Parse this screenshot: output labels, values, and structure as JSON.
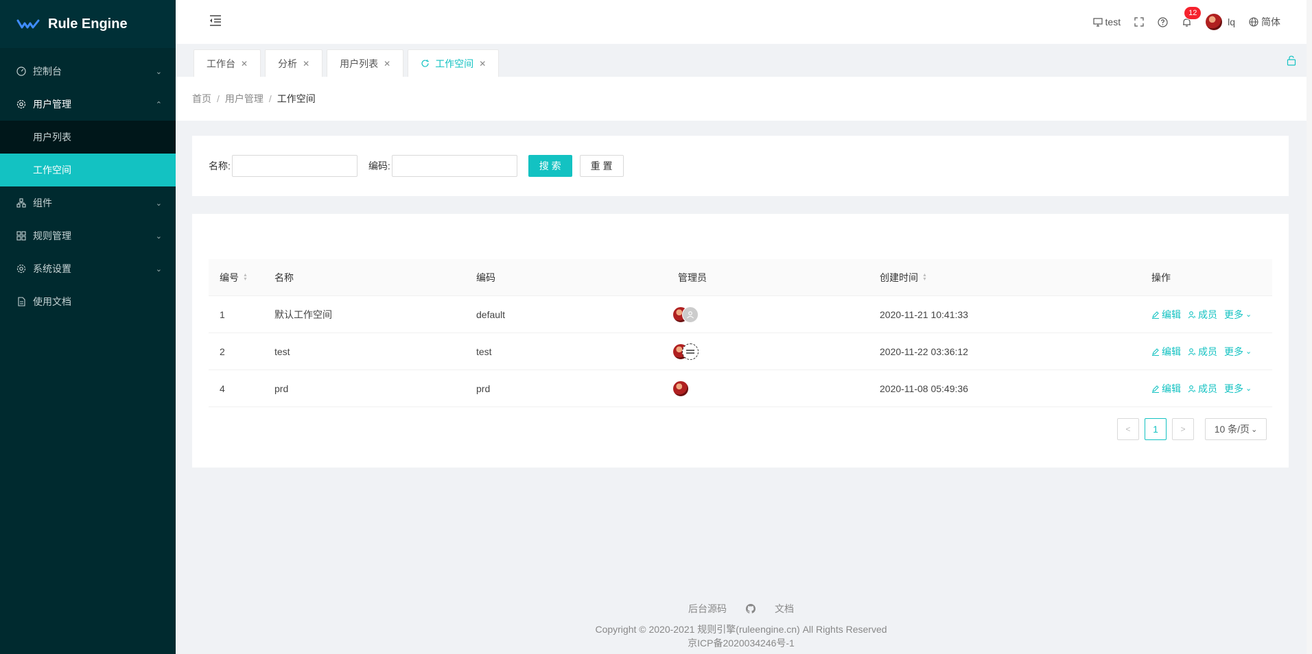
{
  "app": {
    "title": "Rule Engine"
  },
  "sidebar": {
    "items": [
      {
        "label": "控制台",
        "icon": "dashboard-icon"
      },
      {
        "label": "用户管理",
        "icon": "gear-icon",
        "open": true,
        "children": [
          {
            "label": "用户列表"
          },
          {
            "label": "工作空间",
            "active": true
          }
        ]
      },
      {
        "label": "组件",
        "icon": "cluster-icon"
      },
      {
        "label": "规则管理",
        "icon": "appstore-icon"
      },
      {
        "label": "系统设置",
        "icon": "gear-icon"
      },
      {
        "label": "使用文档",
        "icon": "file-icon"
      }
    ]
  },
  "header": {
    "workspace": "test",
    "notification_count": "12",
    "username": "lq",
    "language": "简体"
  },
  "tabs": [
    {
      "label": "工作台"
    },
    {
      "label": "分析"
    },
    {
      "label": "用户列表"
    },
    {
      "label": "工作空间",
      "active": true
    }
  ],
  "breadcrumb": {
    "home": "首页",
    "parent": "用户管理",
    "current": "工作空间"
  },
  "search": {
    "name_label": "名称:",
    "name_value": "",
    "code_label": "编码:",
    "code_value": "",
    "search_button": "搜 索",
    "reset_button": "重 置"
  },
  "table": {
    "columns": {
      "id": "编号",
      "name": "名称",
      "code": "编码",
      "admin": "管理员",
      "created": "创建时间",
      "actions": "操作"
    },
    "rows": [
      {
        "id": "1",
        "name": "默认工作空间",
        "code": "default",
        "created": "2020-11-21 10:41:33"
      },
      {
        "id": "2",
        "name": "test",
        "code": "test",
        "created": "2020-11-22 03:36:12"
      },
      {
        "id": "4",
        "name": "prd",
        "code": "prd",
        "created": "2020-11-08 05:49:36"
      }
    ],
    "actions": {
      "edit": "编辑",
      "members": "成员",
      "more": "更多"
    }
  },
  "pagination": {
    "current": "1",
    "page_size": "10 条/页"
  },
  "footer": {
    "link_source": "后台源码",
    "link_docs": "文档",
    "copyright": "Copyright © 2020-2021 规则引擎(ruleengine.cn) All Rights Reserved",
    "icp": "京ICP备2020034246号-1"
  },
  "colors": {
    "accent": "#13c2c2",
    "sidebar_bg": "#002a2f",
    "badge": "#f5222d"
  }
}
